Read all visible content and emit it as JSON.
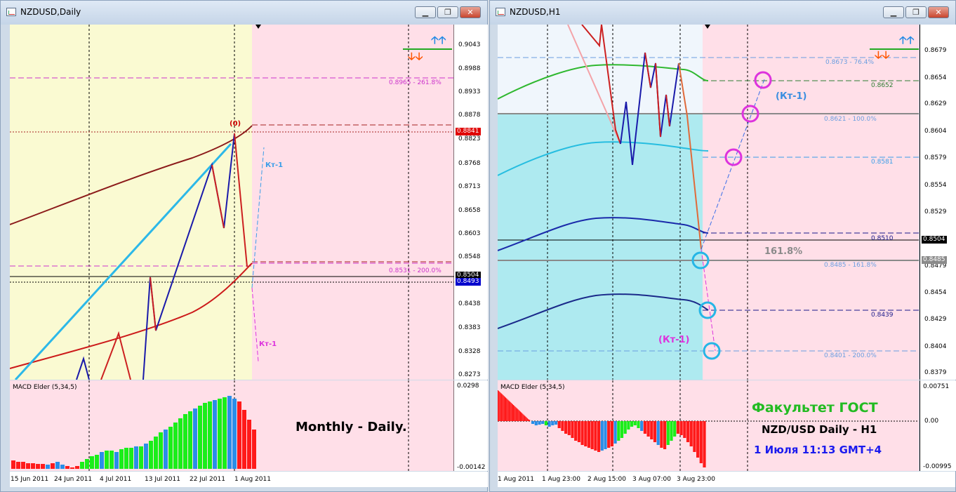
{
  "left_window": {
    "title": "NZDUSD,Daily",
    "price_axis": [
      "0.9043",
      "0.8988",
      "0.8933",
      "0.8878",
      "0.8823",
      "0.8768",
      "0.8713",
      "0.8658",
      "0.8603",
      "0.8548",
      "0.8438",
      "0.8383",
      "0.8328",
      "0.8273"
    ],
    "price_tags": [
      {
        "text": "0.8841",
        "color": "#e00000"
      },
      {
        "text": "0.8504",
        "color": "#000000"
      },
      {
        "text": "0.8493",
        "color": "#0000cc"
      }
    ],
    "fib_labels": [
      "0.8965 - 261.8%",
      "0.8531 - 200.0%"
    ],
    "wave_labels": {
      "zero": "(0)",
      "kt_up": "Кт-1",
      "kt_down": "Кт-1"
    },
    "indicator": {
      "name": "MACD Elder (5,34,5)",
      "axis": [
        "0.0298",
        "-0.00142"
      ]
    },
    "date_axis": [
      "15 Jun 2011",
      "24 Jun 2011",
      "4 Jul 2011",
      "13 Jul 2011",
      "22 Jul 2011",
      "1 Aug 2011"
    ],
    "caption": "Monthly - Daily."
  },
  "right_window": {
    "title": "NZDUSD,H1",
    "price_axis": [
      "0.8679",
      "0.8654",
      "0.8629",
      "0.8604",
      "0.8579",
      "0.8554",
      "0.8529",
      "0.8479",
      "0.8454",
      "0.8429",
      "0.8404",
      "0.8379"
    ],
    "price_tags": [
      {
        "text": "0.8504",
        "color": "#000000"
      },
      {
        "text": "0.8485",
        "color": "#8a8a8a"
      }
    ],
    "fib_labels": [
      "0.8673 - 76.4%",
      "0.8652",
      "0.8621 - 100.0%",
      "0.8581",
      "0.8510",
      "0.8485 - 161.8%",
      "0.8439",
      "0.8401 - 200.0%"
    ],
    "percent_label": "161.8%",
    "wave_labels": {
      "kt_up": "(Кт-1)",
      "kt_down": "(Кт-1)"
    },
    "indicator": {
      "name": "MACD Elder (5,34,5)",
      "axis": [
        "0.00751",
        "0.00",
        "-0.00995"
      ]
    },
    "date_axis": [
      "1 Aug 2011",
      "1 Aug 23:00",
      "2 Aug 15:00",
      "3 Aug 07:00",
      "3 Aug 23:00"
    ],
    "caption_1": "Факультет ГОСТ",
    "caption_2": "NZD/USD Daily - H1",
    "caption_3": "1 Июля 11:13 GMT+4"
  },
  "window_buttons": {
    "minimize": "▁",
    "maximize": "❐",
    "close": "✕"
  },
  "icons": {
    "arrows_up": "arrow-up-icon",
    "arrows_down": "arrow-down-icon"
  }
}
